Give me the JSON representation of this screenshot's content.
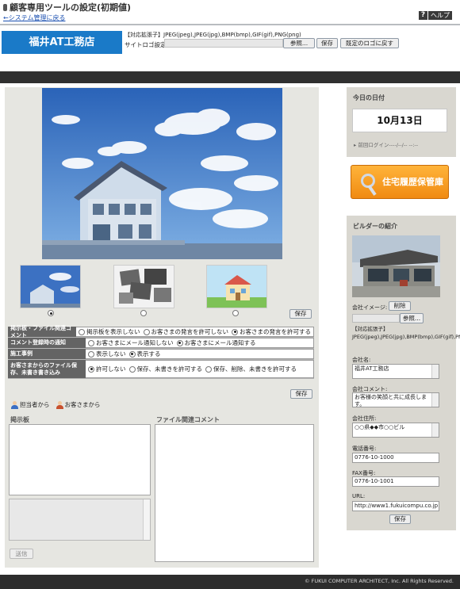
{
  "header": {
    "title": "顧客専用ツールの設定(初期値)",
    "back_link": "←システム管理に戻る",
    "help_label": "ヘルプ",
    "help_icon": "?"
  },
  "logo_area": {
    "company_banner": "福井AT工務店",
    "extensions_note": "【対応拡張子】JPEG(jpeg),JPEG(jpg),BMP(bmp),GIF(gif),PNG(png)",
    "site_logo_label": "サイトロゴ設定:",
    "browse_label": "参照...",
    "save_label": "保存",
    "reset_label": "既定のロゴに戻す"
  },
  "main": {
    "thumbnails": [
      {
        "name": "house-blue-sky",
        "selected": true
      },
      {
        "name": "collage",
        "selected": false
      },
      {
        "name": "illustration-house",
        "selected": false
      }
    ],
    "save_label": "保存",
    "settings": [
      {
        "label": "掲示板・ファイル関連コメント",
        "options": [
          "掲示板を表示しない",
          "お客さまの発言を許可しない",
          "お客さまの発言を許可する"
        ],
        "selected": 2
      },
      {
        "label": "コメント登録時の通知",
        "options": [
          "お客さまにメール通知しない",
          "お客さまにメール通知する"
        ],
        "selected": 1
      },
      {
        "label": "施工事例",
        "options": [
          "表示しない",
          "表示する"
        ],
        "selected": 1
      },
      {
        "label": "お客さまからのファイル保存、未書き書き込み",
        "options": [
          "許可しない",
          "保存、未書きを許可する",
          "保存、削除、未書きを許可する"
        ],
        "selected": 0
      }
    ],
    "settings_save_label": "保存",
    "legend": {
      "staff": "担当者から",
      "customer": "お客さまから"
    },
    "board_title": "掲示板",
    "file_comments_title": "ファイル関連コメント",
    "send_label": "送信"
  },
  "sidebar": {
    "date_heading": "今日の日付",
    "date_value": "10月13日",
    "last_login": "▸ 前回ログイン----/--/-- --:--",
    "history_button": "住宅履歴保管庫",
    "builder_heading": "ビルダーの紹介",
    "company_image_label": "会社イメージ:",
    "delete_label": "削除",
    "browse_label": "参照...",
    "extensions_note": "【対応拡張子】JPEG(jpeg),JPEG(jpg),BMP(bmp),GIF(gif),PNG(png)",
    "fields": {
      "company_name_label": "会社名:",
      "company_name": "福井AT工務店",
      "company_comment_label": "会社コメント:",
      "company_comment": "お客様の笑顔と共に成長します。",
      "company_address_label": "会社住所:",
      "company_address": "○○県◆◆市○○ビル",
      "phone_label": "電話番号:",
      "phone": "0776-10-1000",
      "fax_label": "FAX番号:",
      "fax": "0776-10-1001",
      "url_label": "URL:",
      "url": "http://www1.fukuicompu.co.jp"
    },
    "save_label": "保存"
  },
  "footer": {
    "copyright": "© FUKUI COMPUTER ARCHITECT, Inc. All Rights Reserved."
  },
  "colors": {
    "banner_blue": "#1a7ac8",
    "dark_band": "#303030",
    "panel_gray": "#e6e6e1",
    "sidebar_gray": "#d9d7d0",
    "history_orange": "#f08a12"
  }
}
